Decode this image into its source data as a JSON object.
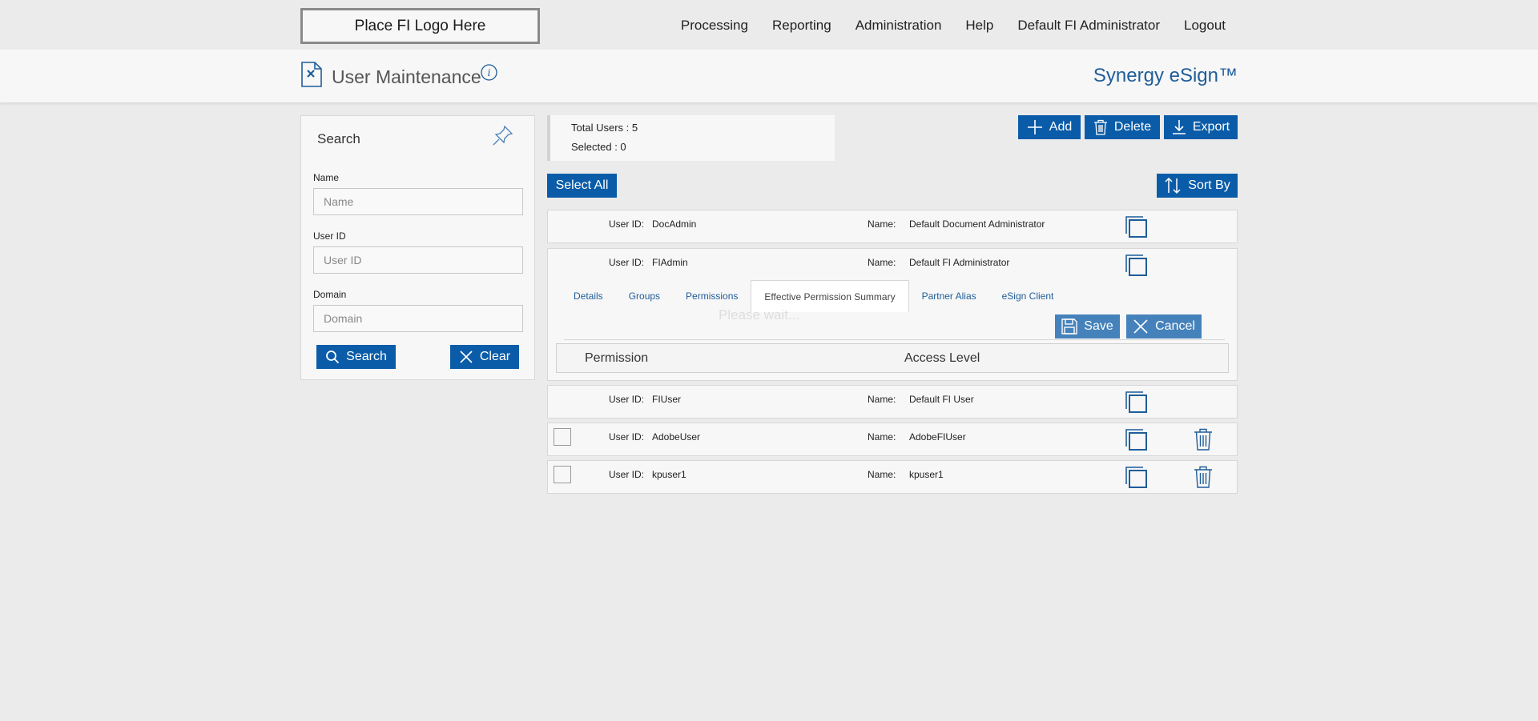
{
  "topbar": {
    "logo_text": "Place FI Logo Here",
    "nav": [
      "Processing",
      "Reporting",
      "Administration",
      "Help",
      "Default FI Administrator",
      "Logout"
    ]
  },
  "header": {
    "title": "User Maintenance",
    "brand": "Synergy eSign™",
    "icons": [
      "document-x-icon",
      "info-icon"
    ]
  },
  "search": {
    "title": "Search",
    "name_label": "Name",
    "name_placeholder": "Name",
    "userid_label": "User ID",
    "userid_placeholder": "User ID",
    "domain_label": "Domain",
    "domain_placeholder": "Domain",
    "search_button": "Search",
    "clear_button": "Clear"
  },
  "summary": {
    "total_users": "Total Users : 5",
    "selected": "Selected : 0"
  },
  "toolbar": {
    "add": "Add",
    "delete": "Delete",
    "export": "Export",
    "select_all": "Select All",
    "sort_by": "Sort By"
  },
  "labels": {
    "user_id": "User ID:",
    "name": "Name:"
  },
  "users": [
    {
      "user_id": "DocAdmin",
      "name": "Default Document Administrator"
    },
    {
      "user_id": "FIAdmin",
      "name": "Default FI Administrator"
    },
    {
      "user_id": "FIUser",
      "name": "Default FI User"
    },
    {
      "user_id": "AdobeUser",
      "name": "AdobeFIUser"
    },
    {
      "user_id": "kpuser1",
      "name": "kpuser1"
    }
  ],
  "expanded": {
    "tabs": [
      "Details",
      "Groups",
      "Permissions",
      "Effective Permission Summary",
      "Partner Alias",
      "eSign Client"
    ],
    "active_tab": "Effective Permission Summary",
    "overlay_text": "Please wait...",
    "save": "Save",
    "cancel": "Cancel",
    "col_permission": "Permission",
    "col_access": "Access Level"
  },
  "colors": {
    "accent": "#0a5ca8",
    "brand_text": "#1f5d99"
  }
}
